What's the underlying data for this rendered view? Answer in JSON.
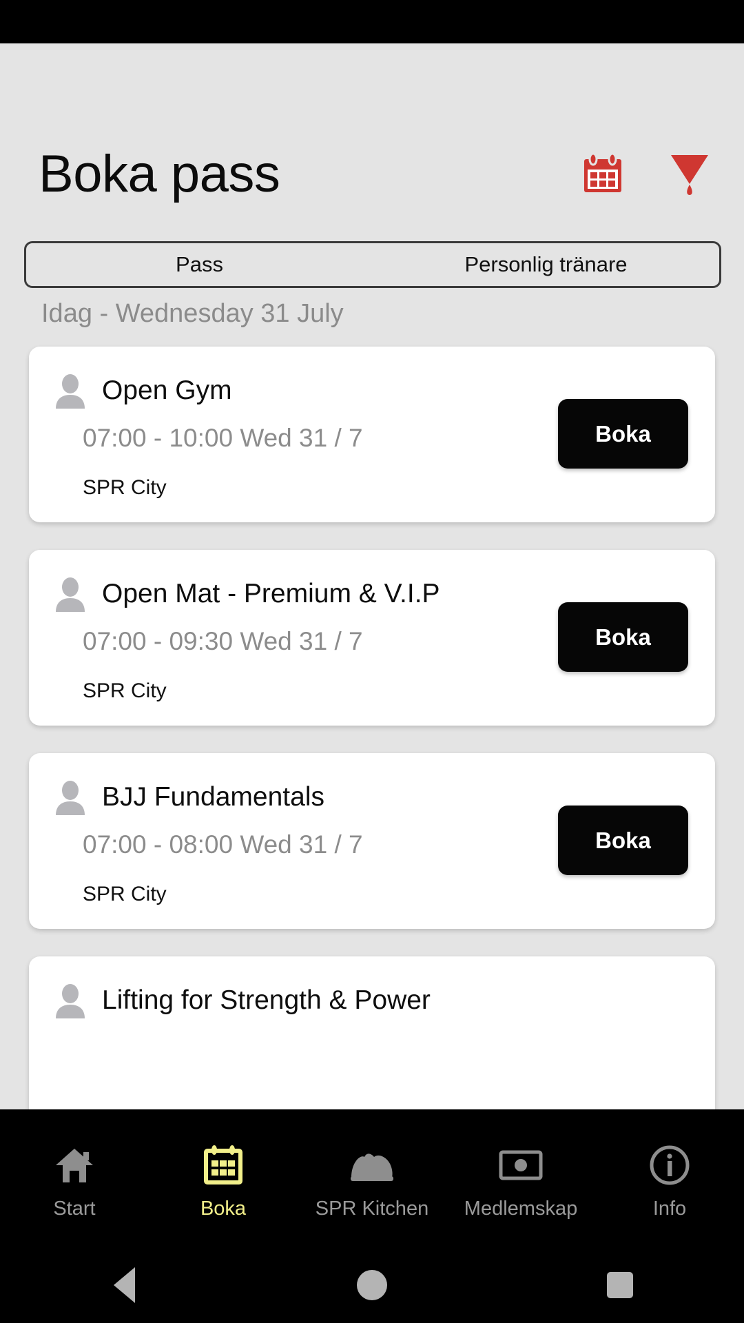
{
  "statusbar": {
    "present": true
  },
  "header": {
    "title": "Boka pass",
    "calendar_icon": "calendar-icon",
    "filter_icon": "filter-funnel-icon",
    "icon_color": "#cf3731"
  },
  "segmented_control": {
    "options": [
      {
        "label": "Pass",
        "selected": true
      },
      {
        "label": "Personlig tränare",
        "selected": false
      }
    ]
  },
  "date_label": "Idag - Wednesday 31 July",
  "classes": [
    {
      "icon": "person-avatar-icon",
      "title": "Open Gym",
      "time": "07:00 - 10:00 Wed 31 / 7",
      "location": "SPR City",
      "button": "Boka"
    },
    {
      "icon": "person-avatar-icon",
      "title": "Open Mat - Premium & V.I.P",
      "time": "07:00 - 09:30 Wed 31 / 7",
      "location": "SPR City",
      "button": "Boka"
    },
    {
      "icon": "person-avatar-icon",
      "title": "BJJ Fundamentals",
      "time": "07:00 - 08:00 Wed 31 / 7",
      "location": "SPR City",
      "button": "Boka"
    },
    {
      "icon": "person-avatar-icon",
      "title": "Lifting for Strength & Power",
      "time": "",
      "location": "",
      "button": ""
    }
  ],
  "tabbar": {
    "active_color": "#f2ef8a",
    "inactive_color": "#9a9a9a",
    "items": [
      {
        "label": "Start",
        "icon": "home-icon",
        "active": false
      },
      {
        "label": "Boka",
        "icon": "calendar-icon",
        "active": true
      },
      {
        "label": "SPR Kitchen",
        "icon": "food-dome-icon",
        "active": false
      },
      {
        "label": "Medlemskap",
        "icon": "membership-card-icon",
        "active": false
      },
      {
        "label": "Info",
        "icon": "info-circle-icon",
        "active": false
      }
    ]
  },
  "android_nav": {
    "back": "back-triangle-icon",
    "home": "home-circle-icon",
    "recents": "recents-square-icon"
  }
}
